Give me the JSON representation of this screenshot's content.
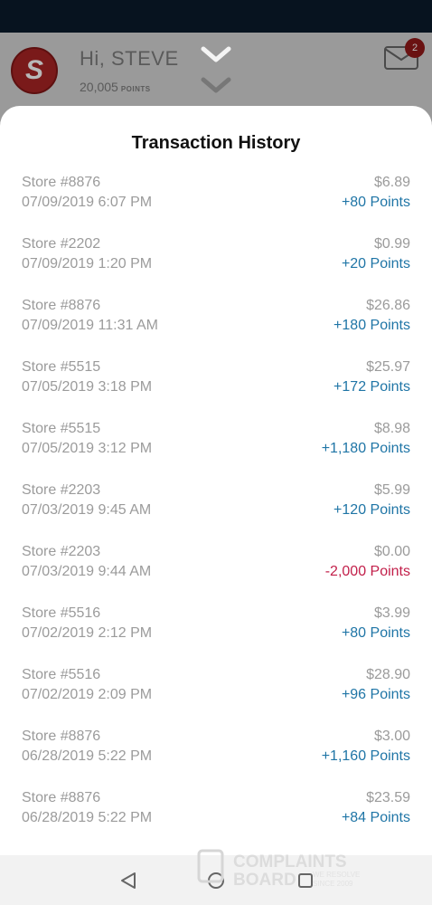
{
  "header": {
    "greeting": "Hi, STEVE",
    "points_value": "20,005",
    "points_label": "POINTS",
    "mail_badge": "2"
  },
  "sheet": {
    "title": "Transaction History"
  },
  "transactions": [
    {
      "store": "Store #8876",
      "date": "07/09/2019 6:07 PM",
      "amount": "$6.89",
      "points": "+80 Points"
    },
    {
      "store": "Store #2202",
      "date": "07/09/2019 1:20 PM",
      "amount": "$0.99",
      "points": "+20 Points"
    },
    {
      "store": "Store #8876",
      "date": "07/09/2019 11:31 AM",
      "amount": "$26.86",
      "points": "+180 Points"
    },
    {
      "store": "Store #5515",
      "date": "07/05/2019 3:18 PM",
      "amount": "$25.97",
      "points": "+172 Points"
    },
    {
      "store": "Store #5515",
      "date": "07/05/2019 3:12 PM",
      "amount": "$8.98",
      "points": "+1,180 Points"
    },
    {
      "store": "Store #2203",
      "date": "07/03/2019 9:45 AM",
      "amount": "$5.99",
      "points": "+120 Points"
    },
    {
      "store": "Store #2203",
      "date": "07/03/2019 9:44 AM",
      "amount": "$0.00",
      "points": "-2,000 Points"
    },
    {
      "store": "Store #5516",
      "date": "07/02/2019 2:12 PM",
      "amount": "$3.99",
      "points": "+80 Points"
    },
    {
      "store": "Store #5516",
      "date": "07/02/2019 2:09 PM",
      "amount": "$28.90",
      "points": "+96 Points"
    },
    {
      "store": "Store #8876",
      "date": "06/28/2019 5:22 PM",
      "amount": "$3.00",
      "points": "+1,160 Points"
    },
    {
      "store": "Store #8876",
      "date": "06/28/2019 5:22 PM",
      "amount": "$23.59",
      "points": "+84 Points"
    }
  ],
  "watermark": {
    "line1": "COMPLAINTS",
    "line2": "BOARD",
    "tagline1": "WE RESOLVE",
    "tagline2": "SINCE 2009"
  },
  "colors": {
    "positive_points": "#1f75a6",
    "negative_points": "#c21f4a",
    "status_bar": "#07131f"
  },
  "icons": [
    "logo-s-icon",
    "chevron-down-icon",
    "mail-icon",
    "back-triangle-icon",
    "home-circle-icon",
    "recents-square-icon"
  ]
}
